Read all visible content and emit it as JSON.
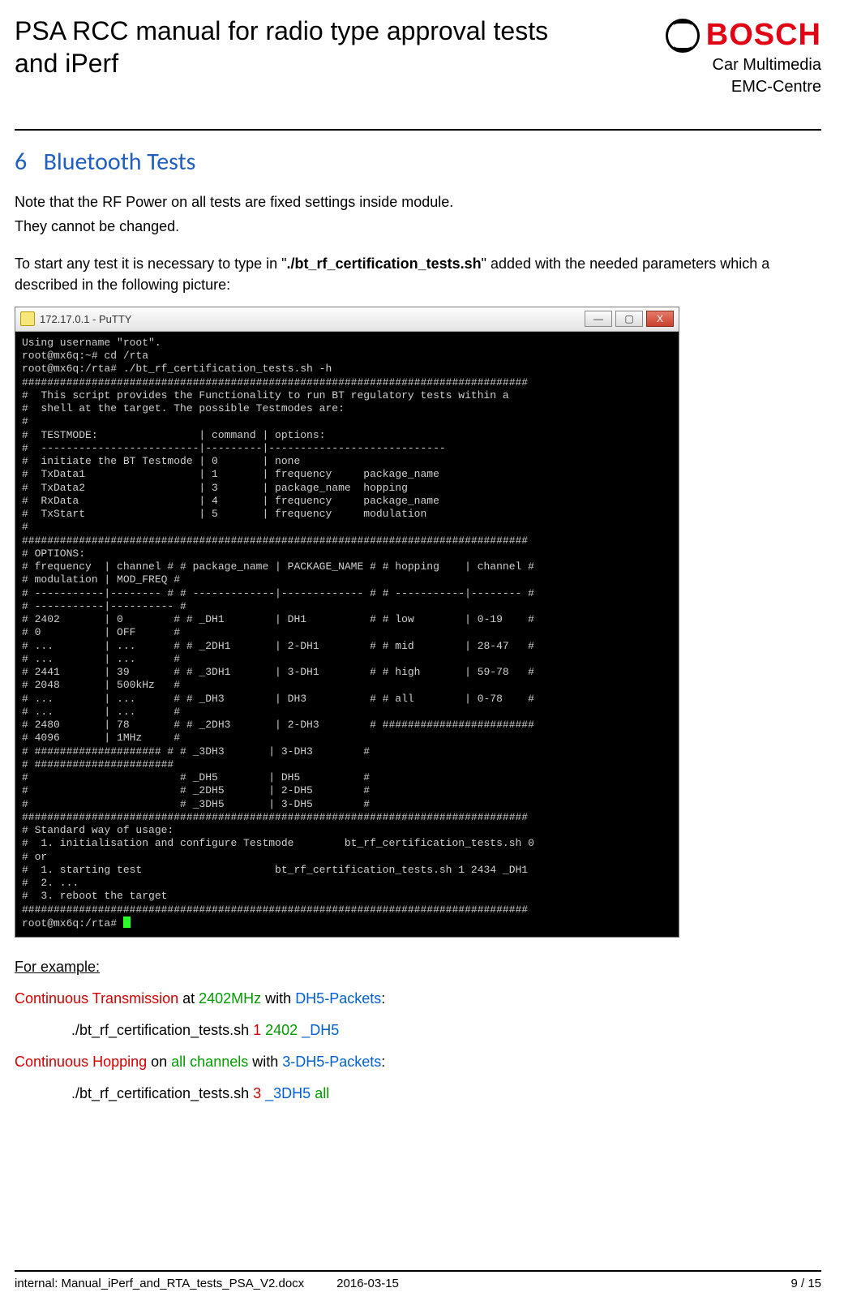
{
  "header": {
    "doc_title": "PSA RCC manual for radio type approval tests and iPerf",
    "brand_word": "BOSCH",
    "brand_sub1": "Car Multimedia",
    "brand_sub2": "EMC-Centre"
  },
  "section": {
    "number": "6",
    "title": "Bluetooth Tests"
  },
  "intro": {
    "p1": "Note that the RF Power on all tests are fixed settings inside module.",
    "p2": "They cannot be changed.",
    "p3_pre": "To start any test it is necessary to type in \"",
    "p3_script": "./bt_rf_certification_tests.sh",
    "p3_post": "\" added with the needed parameters which a described in the following picture:"
  },
  "terminal": {
    "title": "172.17.0.1 - PuTTY",
    "win_min_glyph": "—",
    "win_max_glyph": "▢",
    "win_close_glyph": "X",
    "body_lines": [
      "Using username \"root\".",
      "root@mx6q:~# cd /rta",
      "root@mx6q:/rta# ./bt_rf_certification_tests.sh -h",
      "################################################################################",
      "#  This script provides the Functionality to run BT regulatory tests within a",
      "#  shell at the target. The possible Testmodes are:",
      "#",
      "#  TESTMODE:                | command | options:",
      "#  -------------------------|---------|----------------------------",
      "#  initiate the BT Testmode | 0       | none",
      "#  TxData1                  | 1       | frequency     package_name",
      "#  TxData2                  | 3       | package_name  hopping",
      "#  RxData                   | 4       | frequency     package_name",
      "#  TxStart                  | 5       | frequency     modulation",
      "#",
      "################################################################################",
      "# OPTIONS:",
      "# frequency  | channel # # package_name | PACKAGE_NAME # # hopping    | channel #",
      "# modulation | MOD_FREQ #",
      "# -----------|-------- # # -------------|------------- # # -----------|-------- #",
      "# -----------|---------- #",
      "# 2402       | 0        # # _DH1        | DH1          # # low        | 0-19    #",
      "# 0          | OFF      #",
      "# ...        | ...      # # _2DH1       | 2-DH1        # # mid        | 28-47   #",
      "# ...        | ...      #",
      "# 2441       | 39       # # _3DH1       | 3-DH1        # # high       | 59-78   #",
      "# 2048       | 500kHz   #",
      "# ...        | ...      # # _DH3        | DH3          # # all        | 0-78    #",
      "# ...        | ...      #",
      "# 2480       | 78       # # _2DH3       | 2-DH3        # ########################",
      "# 4096       | 1MHz     #",
      "# #################### # # _3DH3       | 3-DH3        #",
      "# ######################",
      "#                        # _DH5        | DH5          #",
      "#                        # _2DH5       | 2-DH5        #",
      "#                        # _3DH5       | 3-DH5        #",
      "################################################################################",
      "# Standard way of usage:",
      "#  1. initialisation and configure Testmode        bt_rf_certification_tests.sh 0",
      "# or",
      "#  1. starting test                     bt_rf_certification_tests.sh 1 2434 _DH1",
      "#  2. ...",
      "#  3. reboot the target",
      "################################################################################",
      "root@mx6q:/rta# "
    ]
  },
  "examples": {
    "heading": "For example:",
    "line1": {
      "red": "Continuous Transmission",
      "mid1": " at ",
      "green": "2402MHz",
      "mid2": " with ",
      "blue": "DH5-Packets",
      "tail": ":"
    },
    "cmd1": {
      "base": "./bt_rf_certification_tests.sh ",
      "red": "1",
      "sp1": " ",
      "green": "2402",
      "sp2": " ",
      "blue": "_DH5"
    },
    "line2": {
      "red": "Continuous Hopping",
      "mid1": " on ",
      "green": "all channels",
      "mid2": " with ",
      "blue": "3-DH5-Packets",
      "tail": ":"
    },
    "cmd2": {
      "base": "./bt_rf_certification_tests.sh ",
      "red": "3",
      "sp1": " ",
      "blue": "_3DH5",
      "sp2": " ",
      "green": "all"
    }
  },
  "footer": {
    "internal_label": "internal: Manual_iPerf_and_RTA_tests_PSA_V2.docx",
    "date": "2016-03-15",
    "page": "9 / 15"
  }
}
